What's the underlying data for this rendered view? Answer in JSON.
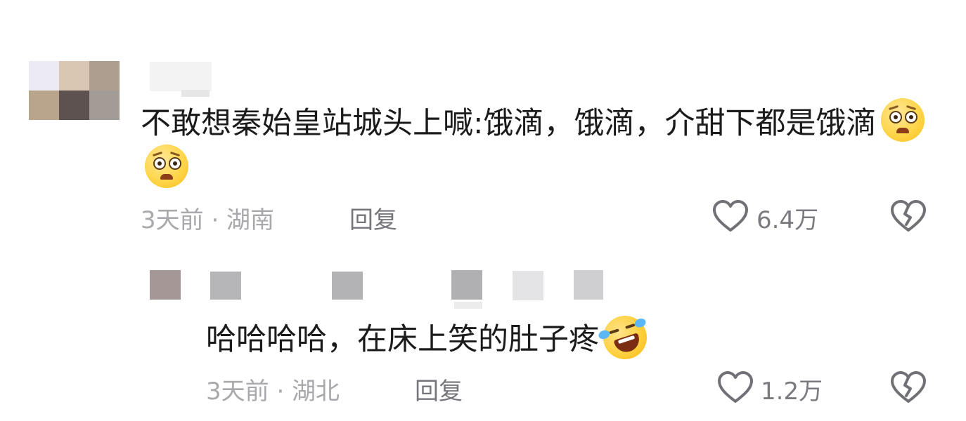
{
  "comment": {
    "text": "不敢想秦始皇站城头上喊:饿滴，饿滴，介甜下都是饿滴",
    "emoji_names": [
      "pleading-face-icon",
      "pleading-face-icon"
    ],
    "time_location": "3天前 · 湖南",
    "reply_label": "回复",
    "like_count": "6.4万"
  },
  "reply": {
    "text": "哈哈哈哈，在床上笑的肚子疼",
    "emoji_name": "rolling-on-floor-laughing-icon",
    "time_location": "3天前 · 湖北",
    "reply_label": "回复",
    "like_count": "1.2万"
  },
  "colors": {
    "meta_gray": "#a8a8ad",
    "reply_gray": "#75757b",
    "text_dark": "#1b1b1b"
  }
}
